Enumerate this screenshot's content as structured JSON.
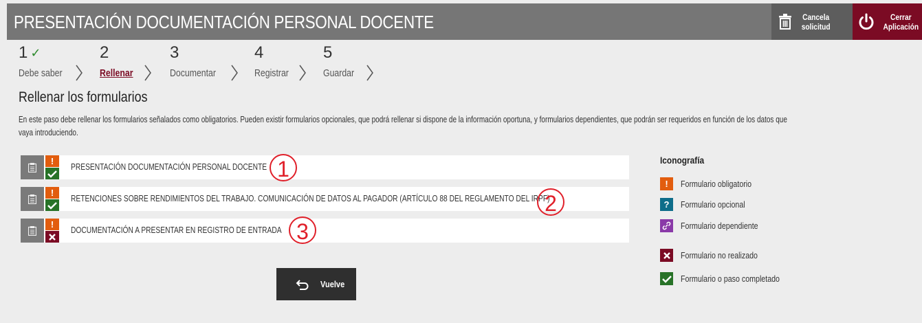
{
  "header": {
    "title": "PRESENTACIÓN DOCUMENTACIÓN PERSONAL DOCENTE",
    "cancel_label_1": "Cancela",
    "cancel_label_2": "solicitud",
    "close_label_1": "Cerrar",
    "close_label_2": "Aplicación"
  },
  "steps": [
    {
      "number": "1",
      "name": "Debe saber",
      "completed": true,
      "check": "✓"
    },
    {
      "number": "2",
      "name": "Rellenar",
      "active": true
    },
    {
      "number": "3",
      "name": "Documentar"
    },
    {
      "number": "4",
      "name": "Registrar"
    },
    {
      "number": "5",
      "name": "Guardar"
    }
  ],
  "main": {
    "title": "Rellenar los formularios",
    "intro": "En este paso debe rellenar los formularios señalados como obligatorios. Pueden existir formularios opcionales, que podrá rellenar si dispone de la información oportuna, y formularios dependientes, que podrán ser requeridos en función de los datos que vaya introduciendo."
  },
  "forms": [
    {
      "label": "PRESENTACIÓN DOCUMENTACIÓN PERSONAL DOCENTE",
      "required_mark": "!",
      "status": "completed",
      "callout": "1"
    },
    {
      "label": "RETENCIONES SOBRE RENDIMIENTOS DEL TRABAJO. COMUNICACIÓN DE DATOS AL PAGADOR (ARTÍCULO 88 DEL REGLAMENTO DEL IRPF)",
      "required_mark": "!",
      "status": "completed",
      "callout": "2"
    },
    {
      "label": "DOCUMENTACIÓN A PRESENTAR EN REGISTRO DE ENTRADA",
      "required_mark": "!",
      "status": "not_done",
      "callout": "3"
    }
  ],
  "legend": {
    "title": "Iconografía",
    "items": [
      {
        "label": "Formulario obligatorio",
        "symbol": "!",
        "color": "#e25d0e"
      },
      {
        "label": "Formulario opcional",
        "symbol": "?",
        "color": "#0e6d8a"
      },
      {
        "label": "Formulario dependiente",
        "symbol": "link-icon",
        "color": "#8a3aa8"
      },
      {
        "label": "Formulario no realizado",
        "symbol": "x-icon",
        "color": "#7b0b24"
      },
      {
        "label": "Formulario o paso completado",
        "symbol": "check-icon",
        "color": "#277227"
      }
    ]
  },
  "back_button": {
    "label": "Vuelve"
  },
  "colors": {
    "header": "#767676",
    "brand": "#7b0b24",
    "required": "#e25d0e",
    "completed": "#277227"
  }
}
